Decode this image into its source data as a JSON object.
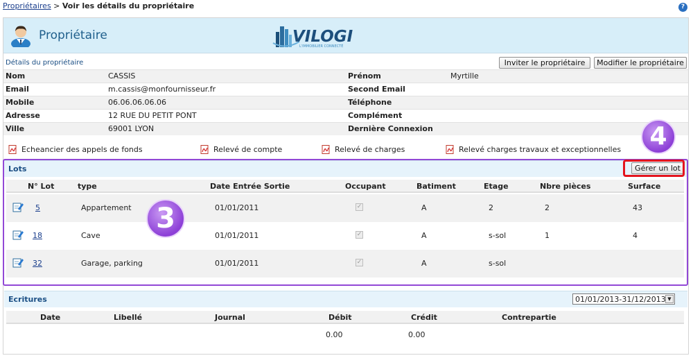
{
  "breadcrumb": {
    "parent": "Propriétaires",
    "separator": ">",
    "current": "Voir les détails du propriétaire"
  },
  "help": "?",
  "header": {
    "title": "Propriétaire",
    "logo_brand": "VILOGI",
    "logo_tagline": "L'IMMOBILIER CONNECTÉ"
  },
  "details": {
    "section_label": "Détails du propriétaire",
    "invite_button": "Inviter le propriétaire",
    "edit_button": "Modifier le propriétaire",
    "rows": [
      {
        "k1": "Nom",
        "v1": "CASSIS",
        "k2": "Prénom",
        "v2": "Myrtille"
      },
      {
        "k1": "Email",
        "v1": "m.cassis@monfournisseur.fr",
        "k2": "Second Email",
        "v2": ""
      },
      {
        "k1": "Mobile",
        "v1": "06.06.06.06.06",
        "k2": "Téléphone",
        "v2": ""
      },
      {
        "k1": "Adresse",
        "v1": "12 RUE DU PETIT PONT",
        "k2": "Complément",
        "v2": ""
      },
      {
        "k1": "Ville",
        "v1": "69001 LYON",
        "k2": "Dernière Connexion",
        "v2": ""
      }
    ]
  },
  "documents": [
    {
      "label": "Echeancier des appels de fonds"
    },
    {
      "label": "Relevé de compte"
    },
    {
      "label": "Relevé de charges"
    },
    {
      "label": "Relevé charges travaux et exceptionnelles"
    }
  ],
  "lots": {
    "title": "Lots",
    "manage_button": "Gérer un lot",
    "headers": [
      "N° Lot",
      "type",
      "Date Entrée Sortie",
      "Occupant",
      "Batiment",
      "Etage",
      "Nbre pièces",
      "Surface"
    ],
    "rows": [
      {
        "num": "5",
        "type": "Appartement",
        "date": "01/01/2011",
        "occupant": true,
        "batiment": "A",
        "etage": "2",
        "pieces": "2",
        "surface": "43"
      },
      {
        "num": "18",
        "type": "Cave",
        "date": "01/01/2011",
        "occupant": true,
        "batiment": "A",
        "etage": "s-sol",
        "pieces": "1",
        "surface": "4"
      },
      {
        "num": "32",
        "type": "Garage, parking",
        "date": "01/01/2011",
        "occupant": true,
        "batiment": "A",
        "etage": "s-sol",
        "pieces": "",
        "surface": ""
      }
    ]
  },
  "ecritures": {
    "title": "Ecritures",
    "period": "01/01/2013-31/12/2013",
    "headers": [
      "Date",
      "Libellé",
      "Journal",
      "Débit",
      "Crédit",
      "Contrepartie"
    ],
    "totals": {
      "debit": "0.00",
      "credit": "0.00"
    }
  },
  "annotations": {
    "badge_3": "3",
    "badge_4": "4"
  },
  "colors": {
    "header_bg": "#d7eef9",
    "link": "#1a3e8c",
    "section_title": "#1a4e84",
    "highlight_purple": "#9248d6",
    "highlight_red": "#e4141d"
  }
}
